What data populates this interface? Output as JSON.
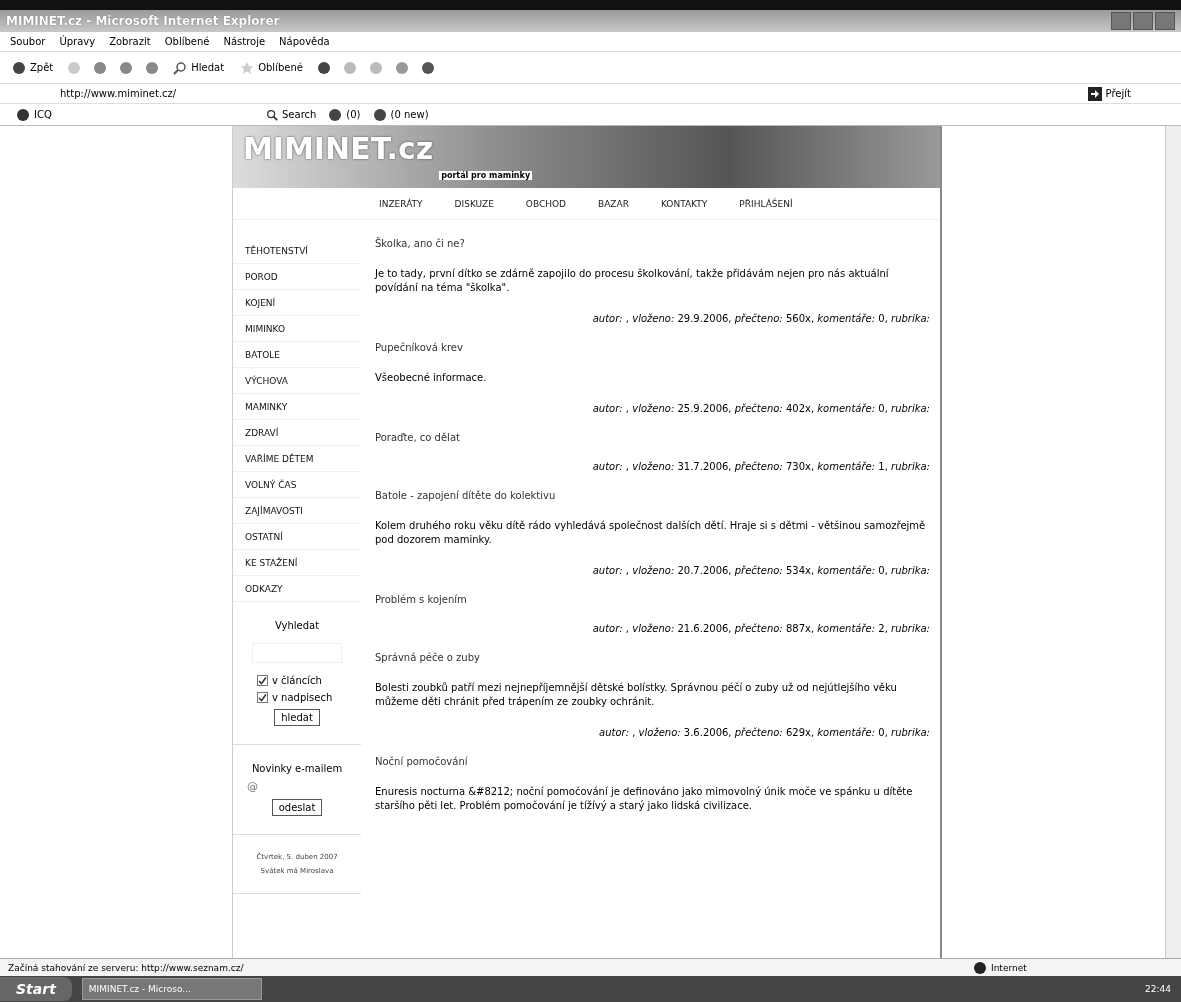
{
  "window": {
    "title": "MIMINET.cz - Microsoft Internet Explorer"
  },
  "menu": [
    "Soubor",
    "Úpravy",
    "Zobrazit",
    "Oblíbené",
    "Nástroje",
    "Nápověda"
  ],
  "toolbar": {
    "back": "Zpět",
    "search": "Hledat",
    "favorites": "Oblíbené"
  },
  "address": {
    "value": "http://www.miminet.cz/",
    "go": "Přejít"
  },
  "icq_bar": {
    "icq": "ICQ",
    "search": "Search",
    "messages": "(0)",
    "mail": "(0 new)"
  },
  "site": {
    "logo": "MIMINET.cz",
    "tagline": "portál pro maminky",
    "nav": [
      "INZERÁTY",
      "DISKUZE",
      "OBCHOD",
      "BAZAR",
      "KONTAKTY",
      "PŘIHLÁŠENÍ"
    ],
    "categories": [
      "TĚHOTENSTVÍ",
      "POROD",
      "KOJENÍ",
      "MIMINKO",
      "BATOLE",
      "VÝCHOVA",
      "MAMINKY",
      "ZDRAVÍ",
      "VAŘÍME DĚTEM",
      "VOLNÝ ČAS",
      "ZAJÍMAVOSTI",
      "OSTATNÍ",
      "KE STAŽENÍ",
      "ODKAZY"
    ],
    "search": {
      "title": "Vyhledat",
      "options": [
        {
          "label": "v článcích",
          "checked": true
        },
        {
          "label": "v nadpisech",
          "checked": true
        }
      ],
      "button": "hledat"
    },
    "newsletter": {
      "title": "Novinky e-mailem",
      "at": "@",
      "button": "odeslat"
    },
    "date": "Čtvrtek, 5. duben 2007",
    "nameday": "Svátek má Miroslava",
    "articles": [
      {
        "title": "Školka, ano či ne?",
        "text": "Je to tady, první dítko se zdárně zapojilo do procesu školkování, takže přidávám nejen pro nás aktuální povídání na téma \"školka\".",
        "meta": "*autor:* , *vloženo:* 29.9.2006, *přečteno:* 560x, *komentáře:* 0, *rubrika:*"
      },
      {
        "title": "Pupečníková krev",
        "text": "Všeobecné informace.",
        "meta": "*autor:* , *vloženo:* 25.9.2006, *přečteno:* 402x, *komentáře:* 0, *rubrika:*"
      },
      {
        "title": "Poraďte, co dělat",
        "meta": "*autor:* , *vloženo:* 31.7.2006, *přečteno:* 730x, *komentáře:* 1, *rubrika:*"
      },
      {
        "title": "Batole - zapojení dítěte do kolektivu",
        "text": "Kolem druhého roku věku dítě rádo vyhledává společnost dalších dětí. Hraje si s dětmi - většinou samozřejmě pod dozorem maminky.",
        "meta": "*autor:* , *vloženo:* 20.7.2006, *přečteno:* 534x, *komentáře:* 0, *rubrika:*"
      },
      {
        "title": "Problém s kojením",
        "meta": "*autor:* , *vloženo:* 21.6.2006, *přečteno:* 887x, *komentáře:* 2, *rubrika:*"
      },
      {
        "title": "Správná péče o zuby",
        "text": "Bolesti zoubků patří mezi nejnepříjemnější dětské bolístky. Správnou péčí o zuby už od nejútlejšího věku můžeme děti chránit před trápením ze zoubky ochránit.",
        "meta": "*autor:* , *vloženo:* 3.6.2006, *přečteno:* 629x, *komentáře:* 0, *rubrika:*"
      },
      {
        "title": "Noční pomočování",
        "text": "Enuresis nocturna &#8212; noční pomočování je definováno jako mimovolný únik moče ve spánku u dítěte staršího pěti let. Problém pomočování je tížívý a starý jako lidská civilizace."
      }
    ]
  },
  "status_bar": {
    "text": "Začíná stahování ze serveru: http://www.seznam.cz/",
    "zone": "Internet"
  },
  "taskbar": {
    "start": "Start",
    "task": "MIMINET.cz - Microso...",
    "clock": "22:44"
  }
}
